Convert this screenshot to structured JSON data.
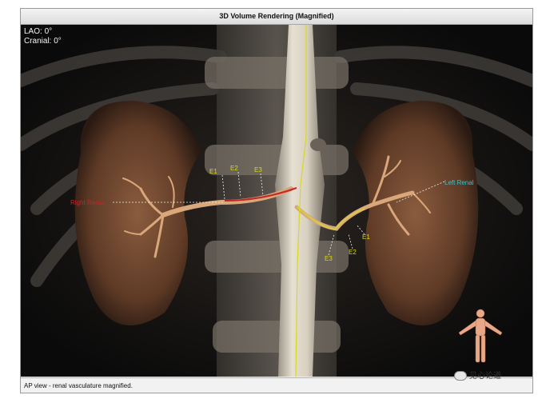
{
  "window": {
    "title": "3D Volume Rendering (Magnified)"
  },
  "orientation": {
    "lao": "LAO: 0°",
    "cranial": "Cranial: 0°"
  },
  "annotations": {
    "right_renal": "Right Renal",
    "left_renal": "Left Renal",
    "right_e1": "E1",
    "right_e2": "E2",
    "right_e3": "E3",
    "left_e1": "E1",
    "left_e2": "E2",
    "left_e3": "E3"
  },
  "colors": {
    "right_renal_line": "#c0282a",
    "left_renal_line": "#d4d23a",
    "left_renal_label": "#3ec0c8",
    "centerline": "#d8d820"
  },
  "status": {
    "text": "AP view - renal vasculature magnified."
  },
  "watermark": {
    "text": "见心论道"
  }
}
